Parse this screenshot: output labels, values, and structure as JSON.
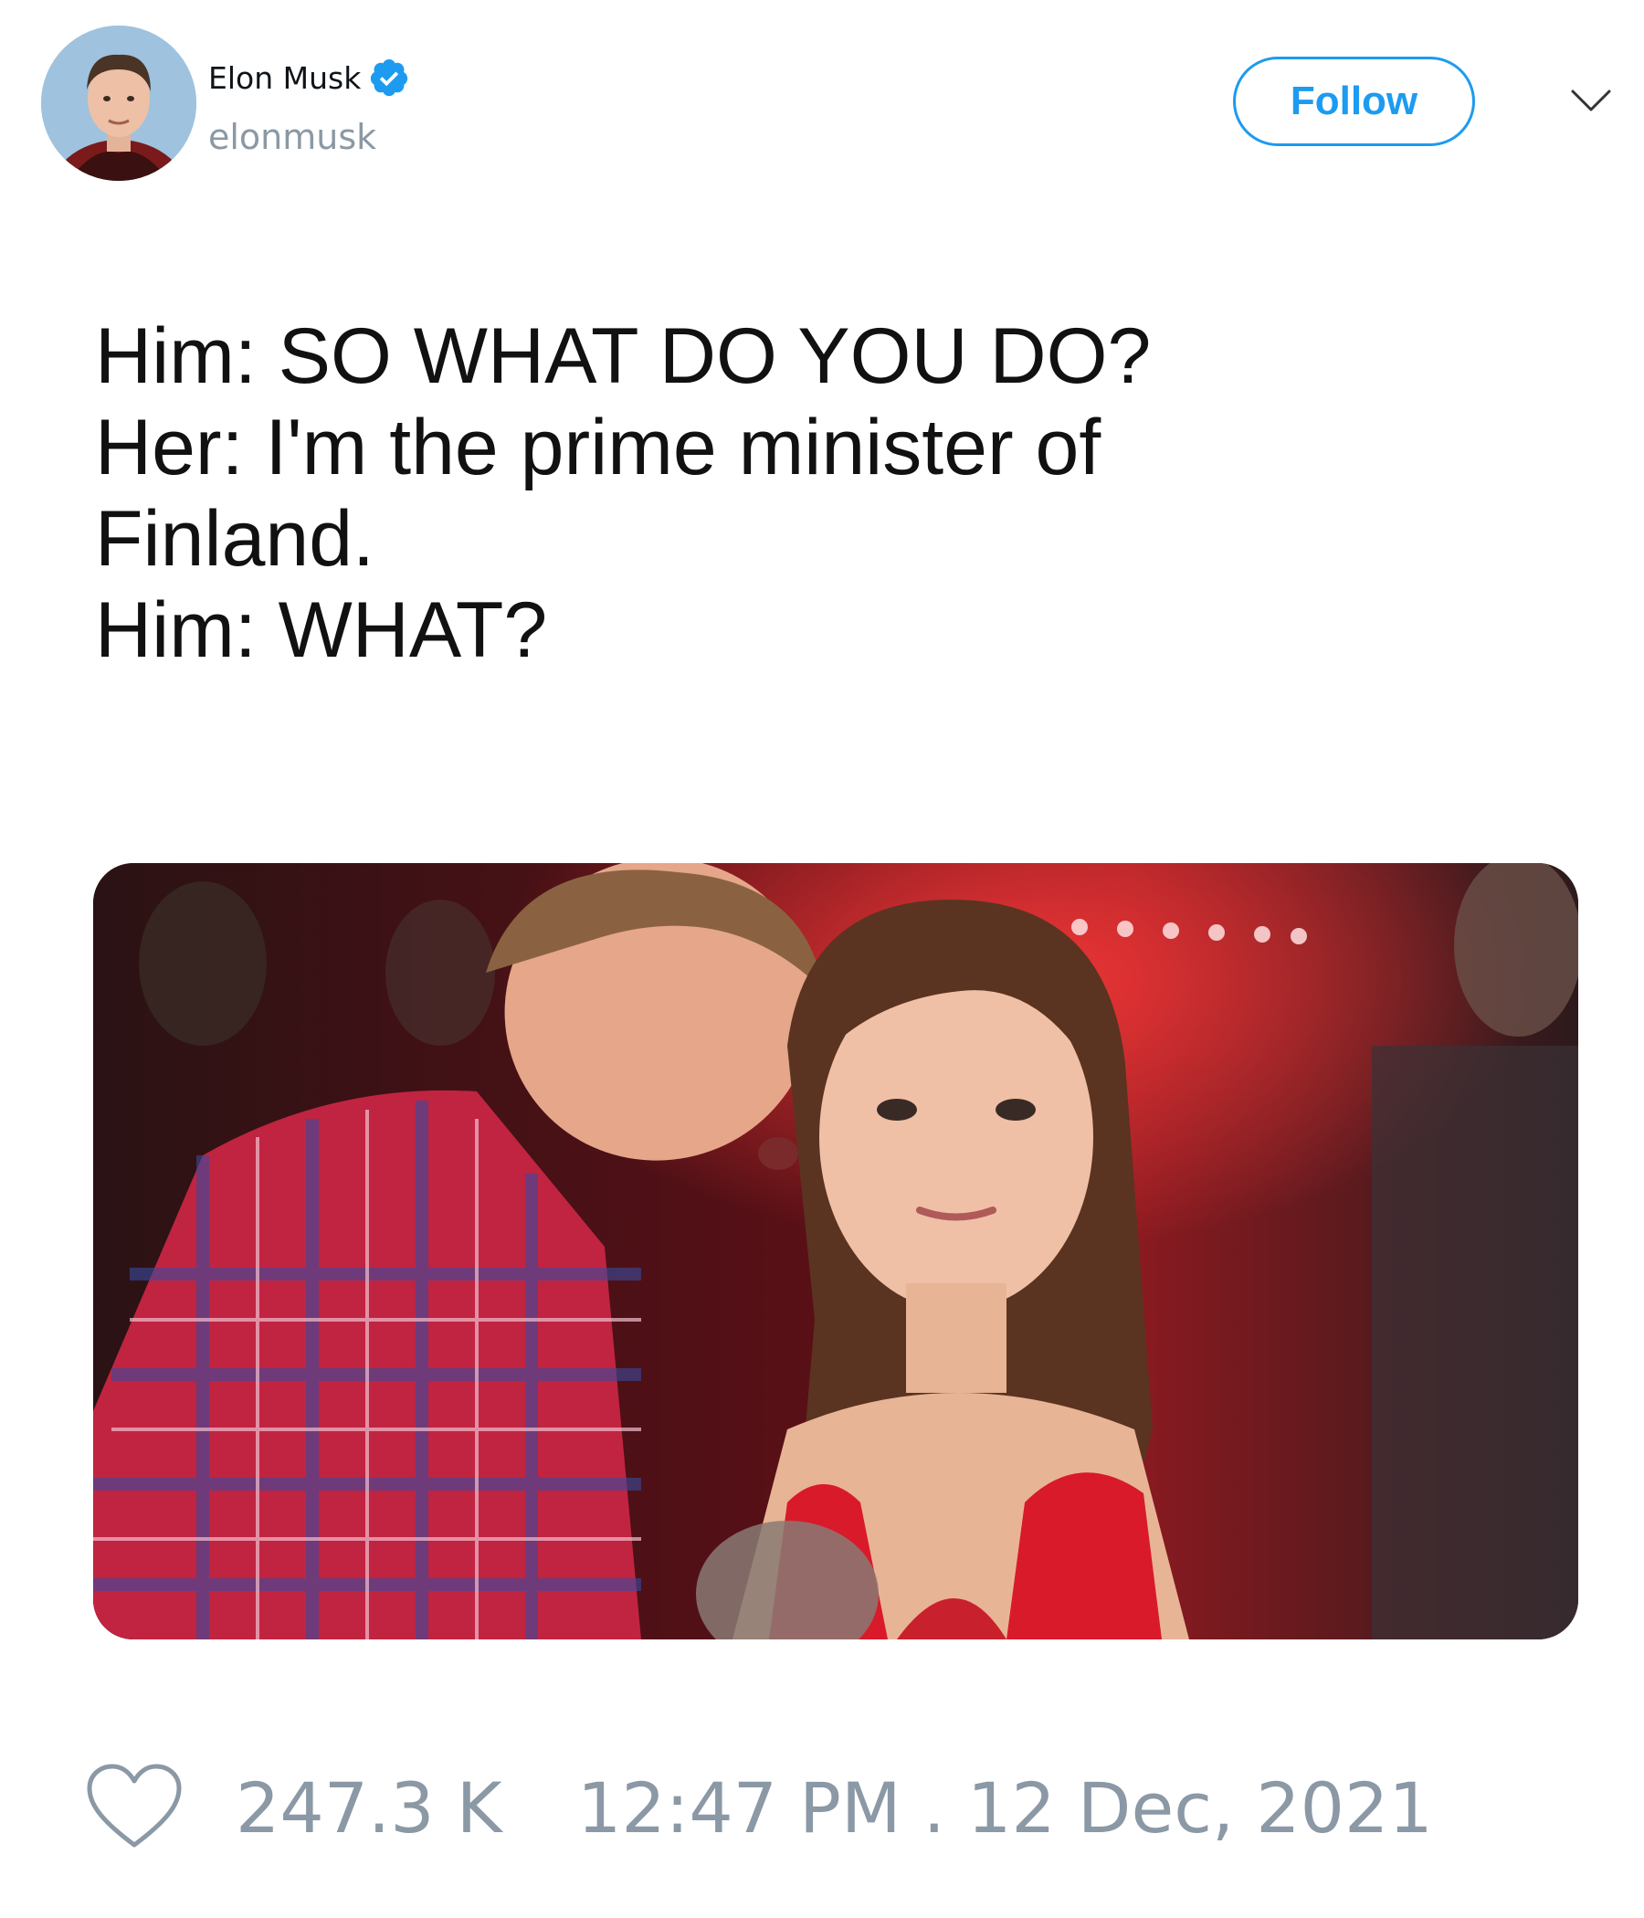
{
  "author": {
    "name": "Elon Musk",
    "handle": "elonmusk",
    "verified": true
  },
  "header": {
    "follow_label": "Follow",
    "menu_icon": "chevron-down-icon"
  },
  "tweet": {
    "lines": [
      "Him: SO WHAT DO YOU DO?",
      "Her: I'm the prime minister of",
      "Finland.",
      "Him: WHAT?"
    ]
  },
  "footer": {
    "likes": "247.3 K",
    "timestamp": "12:47 PM . 12 Dec, 2021",
    "like_icon": "heart-icon"
  },
  "colors": {
    "accent": "#1d9bf0",
    "muted": "#8b98a5",
    "text": "#111111"
  }
}
